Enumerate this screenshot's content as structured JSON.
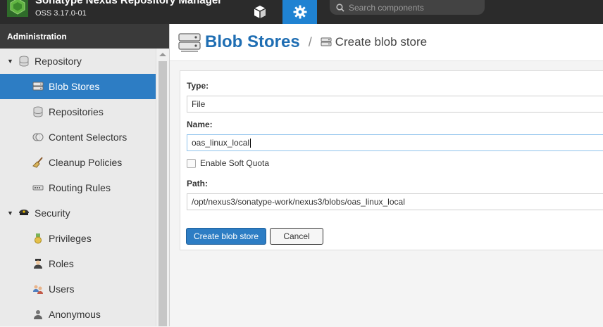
{
  "header": {
    "app_title": "Sonatype Nexus Repository Manager",
    "version": "OSS 3.17.0-01",
    "search_placeholder": "Search components",
    "browse_icon": "cube-icon",
    "admin_icon": "gear-icon",
    "colors": {
      "bar": "#2b2b2b",
      "active": "#1f82d2"
    }
  },
  "sidebar": {
    "heading": "Administration",
    "items": [
      {
        "label": "Repository",
        "icon": "database-icon",
        "kind": "group"
      },
      {
        "label": "Blob Stores",
        "icon": "blob-store-icon",
        "kind": "child",
        "selected": true
      },
      {
        "label": "Repositories",
        "icon": "database-icon",
        "kind": "child"
      },
      {
        "label": "Content Selectors",
        "icon": "content-selector-icon",
        "kind": "child"
      },
      {
        "label": "Cleanup Policies",
        "icon": "broom-icon",
        "kind": "child"
      },
      {
        "label": "Routing Rules",
        "icon": "routing-icon",
        "kind": "child"
      },
      {
        "label": "Security",
        "icon": "police-hat-icon",
        "kind": "group"
      },
      {
        "label": "Privileges",
        "icon": "medal-icon",
        "kind": "child"
      },
      {
        "label": "Roles",
        "icon": "role-icon",
        "kind": "child"
      },
      {
        "label": "Users",
        "icon": "users-icon",
        "kind": "child"
      },
      {
        "label": "Anonymous",
        "icon": "anonymous-icon",
        "kind": "child"
      }
    ]
  },
  "breadcrumb": {
    "title": "Blob Stores",
    "separator": "/",
    "subtitle": "Create blob store"
  },
  "form": {
    "type_label": "Type:",
    "type_value": "File",
    "name_label": "Name:",
    "name_value": "oas_linux_local",
    "soft_quota_label": "Enable Soft Quota",
    "soft_quota_checked": false,
    "path_label": "Path:",
    "path_value": "/opt/nexus3/sonatype-work/nexus3/blobs/oas_linux_local",
    "create_button": "Create blob store",
    "cancel_button": "Cancel"
  }
}
